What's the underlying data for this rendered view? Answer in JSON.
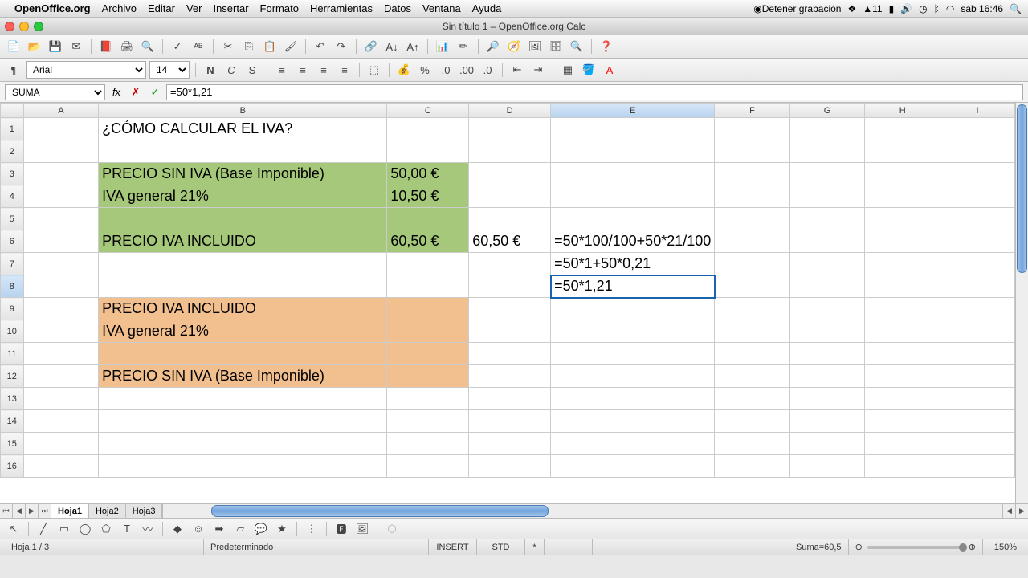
{
  "menubar": {
    "appname": "OpenOffice.org",
    "items": [
      "Archivo",
      "Editar",
      "Ver",
      "Insertar",
      "Formato",
      "Herramientas",
      "Datos",
      "Ventana",
      "Ayuda"
    ],
    "right": {
      "record": "Detener grabación",
      "adobe": "11",
      "clock": "sáb 16:46"
    }
  },
  "window": {
    "title": "Sin título 1 – OpenOffice.org Calc"
  },
  "format_toolbar": {
    "font": "Arial",
    "size": "14"
  },
  "formulabar": {
    "cellref": "SUMA",
    "formula": "=50*1,21"
  },
  "columns": [
    "A",
    "B",
    "C",
    "D",
    "E",
    "F",
    "G",
    "H",
    "I"
  ],
  "rows": [
    "1",
    "2",
    "3",
    "4",
    "5",
    "6",
    "7",
    "8",
    "9",
    "10",
    "11",
    "12",
    "13",
    "14",
    "15",
    "16"
  ],
  "cells": {
    "B1": "¿CÓMO CALCULAR EL IVA?",
    "B3": "PRECIO SIN IVA (Base Imponible)",
    "C3": "50,00 €",
    "B4": "IVA general 21%",
    "C4": "10,50 €",
    "B6": "PRECIO IVA INCLUIDO",
    "C6": "60,50 €",
    "D6": "60,50 €",
    "E6": "=50*100/100+50*21/100",
    "E7": "=50*1+50*0,21",
    "E8": "=50*1,21",
    "B9": "PRECIO IVA INCLUIDO",
    "B10": "IVA general 21%",
    "B12": "PRECIO SIN IVA (Base Imponible)"
  },
  "tabs": {
    "active": "Hoja1",
    "list": [
      "Hoja1",
      "Hoja2",
      "Hoja3"
    ]
  },
  "statusbar": {
    "sheet": "Hoja 1 / 3",
    "style": "Predeterminado",
    "mode": "INSERT",
    "std": "STD",
    "star": "*",
    "sum": "Suma=60,5",
    "zoom": "150%"
  }
}
